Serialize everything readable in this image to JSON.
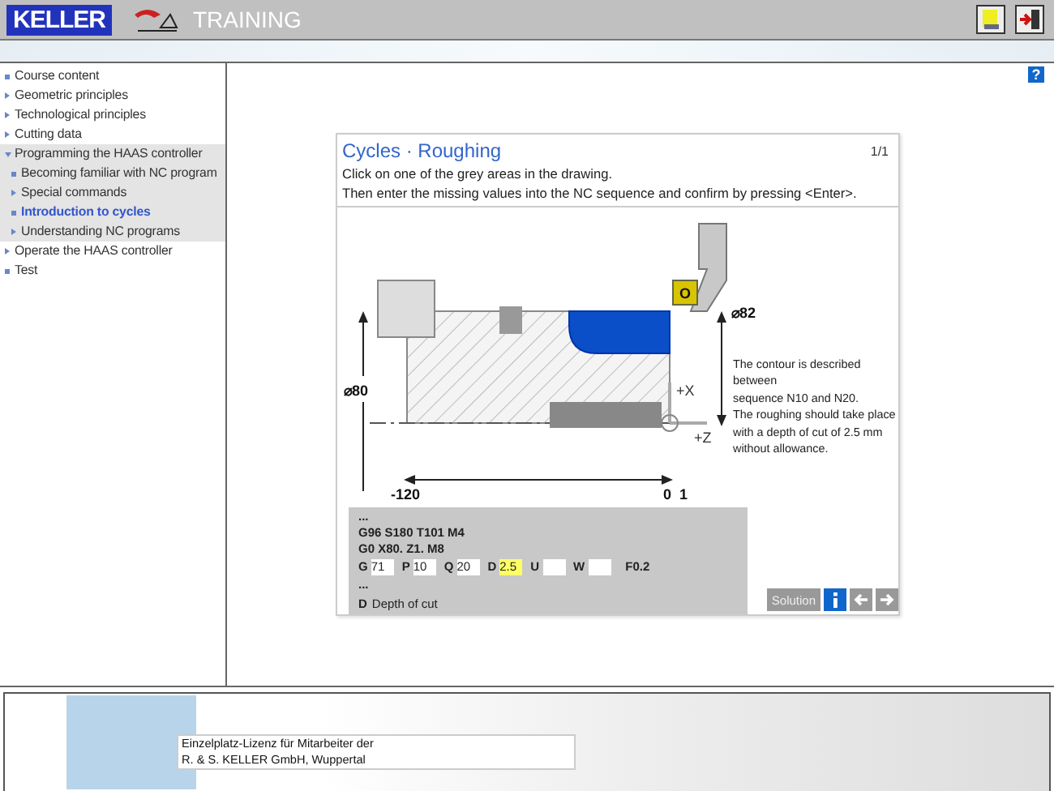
{
  "header": {
    "logo": "KELLER",
    "title": "TRAINING"
  },
  "nav": [
    {
      "label": "Course content",
      "kind": "page",
      "selected": false
    },
    {
      "label": "Geometric principles",
      "kind": "chapter",
      "selected": false
    },
    {
      "label": "Technological principles",
      "kind": "chapter",
      "selected": false
    },
    {
      "label": "Cutting data",
      "kind": "chapter",
      "selected": false
    },
    {
      "label": "Programming the HAAS controller",
      "kind": "chapter",
      "expanded": true,
      "selected": false,
      "children": [
        {
          "label": "Becoming familiar with NC program",
          "kind": "page",
          "selected": false
        },
        {
          "label": "Special commands",
          "kind": "chapter",
          "selected": false
        },
        {
          "label": "Introduction to cycles",
          "kind": "page",
          "selected": true
        },
        {
          "label": "Understanding NC programs",
          "kind": "chapter",
          "selected": false
        }
      ]
    },
    {
      "label": "Operate the HAAS controller",
      "kind": "chapter",
      "selected": false
    },
    {
      "label": "Test",
      "kind": "page",
      "selected": false
    }
  ],
  "help": "?",
  "lesson": {
    "title": "Cycles · Roughing",
    "page": "1/1",
    "instructions": [
      "Click on one of the grey areas in the drawing.",
      "Then enter the missing values into the NC sequence and confirm by pressing <Enter>."
    ],
    "drawing": {
      "insert_label": "O",
      "dia_outer": "⌀82",
      "dia_inner": "⌀80",
      "z_start": "-120",
      "z_zero": "0",
      "z_one": "1",
      "axis_x": "+X",
      "axis_z": "+Z"
    },
    "description": "The contour is described\nbetween\nsequence N10 and N20.\nThe roughing should take place\nwith a depth of cut of 2.5 mm\nwithout allowance.",
    "nc_code": {
      "lines": [
        "...",
        "G96 S180 T101 M4",
        "G0 X80. Z1. M8"
      ],
      "fields": [
        {
          "label": "G",
          "value": "71",
          "selected": false
        },
        {
          "label": "P",
          "value": "10",
          "selected": false
        },
        {
          "label": "Q",
          "value": "20",
          "selected": false
        },
        {
          "label": "D",
          "value": "2.5",
          "selected": true
        },
        {
          "label": "U",
          "selected": false
        },
        {
          "label": "W",
          "selected": false
        }
      ],
      "tail": "F0.2",
      "after": "...",
      "hint_key": "D",
      "hint": "Depth of cut"
    },
    "buttons": {
      "solution": "Solution"
    }
  },
  "footer": {
    "license": [
      "Einzelplatz-Lizenz für Mitarbeiter der",
      "R. & S. KELLER GmbH, Wuppertal"
    ]
  }
}
